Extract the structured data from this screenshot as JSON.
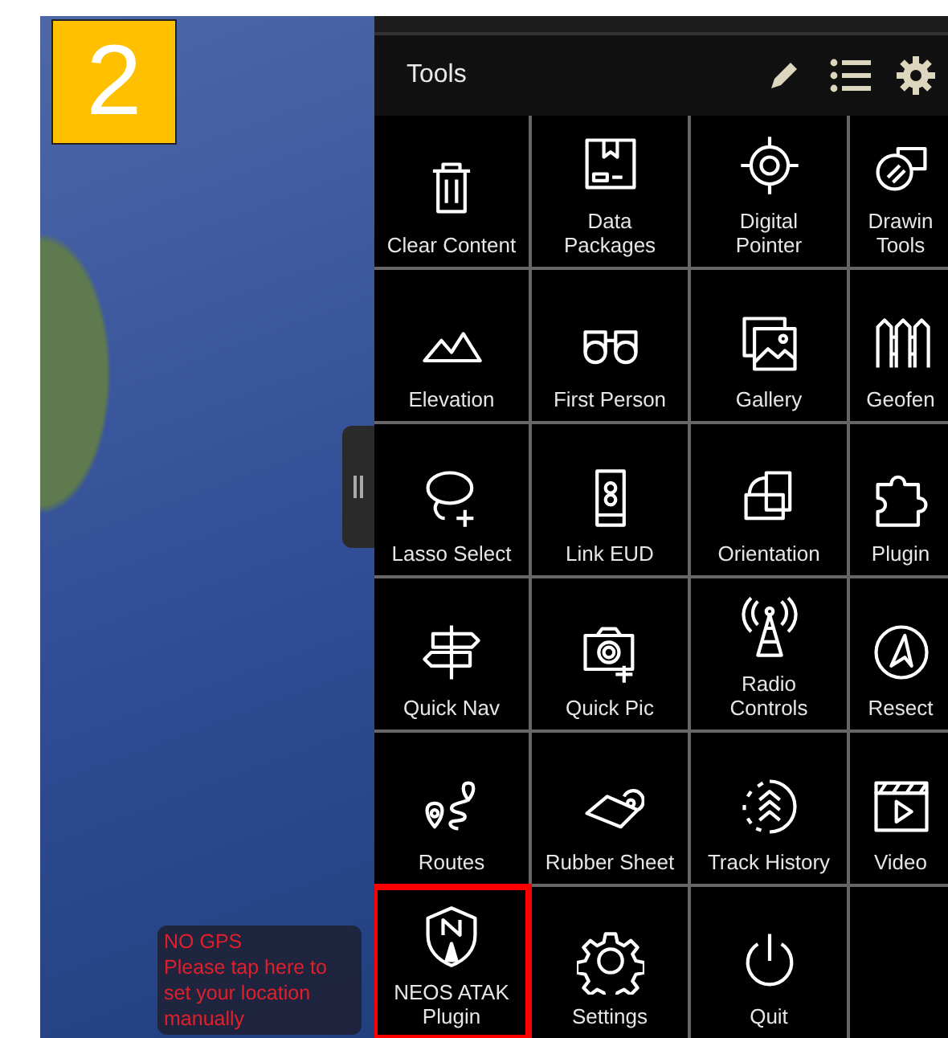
{
  "badge": "2",
  "gps_notice": {
    "title": "NO GPS",
    "message": "Please tap here to set your location manually"
  },
  "panel": {
    "title": "Tools",
    "tools": [
      {
        "label": "Clear Content",
        "highlighted": false
      },
      {
        "label": "Data\nPackages",
        "highlighted": false
      },
      {
        "label": "Digital\nPointer",
        "highlighted": false
      },
      {
        "label": "Drawin\nTools",
        "highlighted": false
      },
      {
        "label": "Elevation",
        "highlighted": false
      },
      {
        "label": "First Person",
        "highlighted": false
      },
      {
        "label": "Gallery",
        "highlighted": false
      },
      {
        "label": "Geofen",
        "highlighted": false
      },
      {
        "label": "Lasso Select",
        "highlighted": false
      },
      {
        "label": "Link EUD",
        "highlighted": false
      },
      {
        "label": "Orientation",
        "highlighted": false
      },
      {
        "label": "Plugin",
        "highlighted": false
      },
      {
        "label": "Quick Nav",
        "highlighted": false
      },
      {
        "label": "Quick Pic",
        "highlighted": false
      },
      {
        "label": "Radio\nControls",
        "highlighted": false
      },
      {
        "label": "Resect",
        "highlighted": false
      },
      {
        "label": "Routes",
        "highlighted": false
      },
      {
        "label": "Rubber Sheet",
        "highlighted": false
      },
      {
        "label": "Track History",
        "highlighted": false
      },
      {
        "label": "Video",
        "highlighted": false
      },
      {
        "label": "NEOS ATAK\nPlugin",
        "highlighted": true
      },
      {
        "label": "Settings",
        "highlighted": false
      },
      {
        "label": "Quit",
        "highlighted": false
      }
    ]
  }
}
